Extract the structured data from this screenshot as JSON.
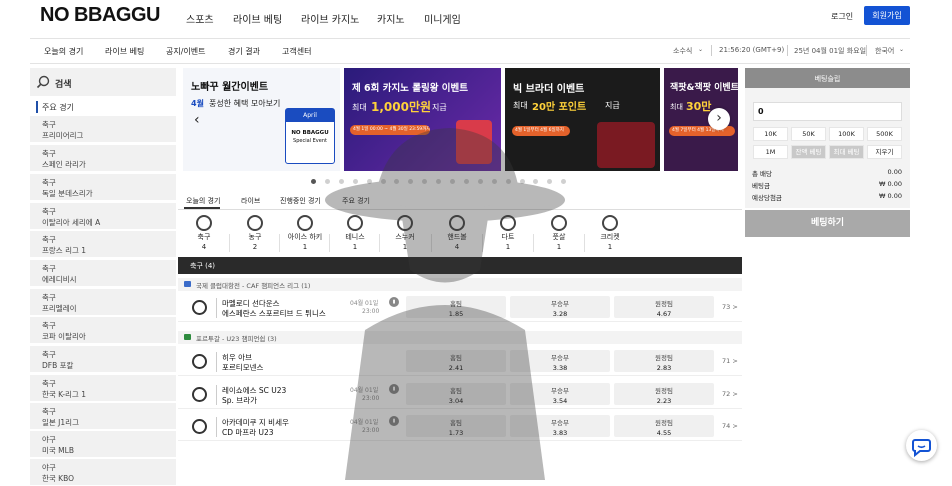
{
  "header": {
    "logo": "NO BBAGGU",
    "nav": [
      "스포츠",
      "라이브 베팅",
      "라이브 카지노",
      "카지노",
      "미니게임"
    ],
    "login": "로그인",
    "signup": "회원가입"
  },
  "subnav": {
    "items": [
      "오늘의 경기",
      "라이브 베팅",
      "공지/이벤트",
      "경기 결과",
      "고객센터"
    ],
    "odds_format": "소수식",
    "time": "21:56:20 (GMT+9)",
    "date": "25년 04월 01일 화요일",
    "language": "한국어"
  },
  "sidebar": {
    "search": "검색",
    "main_games": "주요 경기",
    "items": [
      {
        "cat": "축구",
        "league": "프리미어리그"
      },
      {
        "cat": "축구",
        "league": "스페인 라리가"
      },
      {
        "cat": "축구",
        "league": "독일 분데스리가"
      },
      {
        "cat": "축구",
        "league": "이탈리아 세리에 A"
      },
      {
        "cat": "축구",
        "league": "프랑스 리그 1"
      },
      {
        "cat": "축구",
        "league": "에레디비시"
      },
      {
        "cat": "축구",
        "league": "프리멜레이"
      },
      {
        "cat": "축구",
        "league": "코파 이탈리아"
      },
      {
        "cat": "축구",
        "league": "DFB 포칼"
      },
      {
        "cat": "축구",
        "league": "한국 K-리그 1"
      },
      {
        "cat": "축구",
        "league": "일본 J1리그"
      },
      {
        "cat": "야구",
        "league": "미국 MLB"
      },
      {
        "cat": "야구",
        "league": "한국 KBO"
      }
    ]
  },
  "banners": [
    {
      "title": "노빠꾸 월간이벤트",
      "sub1": "4월",
      "sub2": "풍성한 혜택 모아보기",
      "badge_month": "April",
      "badge_logo": "NO BBAGGU",
      "badge_sub": "Special Event"
    },
    {
      "title": "제 6회 카지노 롤링왕 이벤트",
      "sub1": "최대",
      "highlight": "1,000만원",
      "sub2": "지급",
      "date": "4월 1일 00:00 ~ 4월 30일 23:59까지"
    },
    {
      "title": "빅 브라더 이벤트",
      "sub1": "최대",
      "highlight": "20만 포인트",
      "sub2": "지급",
      "date": "4월 1일부터 4월 6일까지"
    },
    {
      "title": "잭팟&잭팟 이벤트",
      "sub1": "최대",
      "highlight": "30만",
      "date": "4월 7일부터 4월 13일까지"
    }
  ],
  "carousel_dots": 19,
  "tabs": [
    "오늘의 경기",
    "라이브",
    "진행중인 경기",
    "주요 경기"
  ],
  "sports": [
    {
      "name": "축구",
      "count": "4"
    },
    {
      "name": "농구",
      "count": "2"
    },
    {
      "name": "아이스 하키",
      "count": "1"
    },
    {
      "name": "테니스",
      "count": "1"
    },
    {
      "name": "스누커",
      "count": "1"
    },
    {
      "name": "핸드볼",
      "count": "4"
    },
    {
      "name": "다트",
      "count": "1"
    },
    {
      "name": "풋살",
      "count": "1"
    },
    {
      "name": "크리켓",
      "count": "1"
    }
  ],
  "section_header": "축구 (4)",
  "leagues": [
    {
      "name": "국제 클럽대항전 - CAF 챔피언스 리그 (1)",
      "flag": "#3a6bc9"
    },
    {
      "name": "포르투갈 - U23 챔피언쉽 (3)",
      "flag": "#2e8b3e"
    }
  ],
  "matches": [
    {
      "home": "마멜로디 선다운스",
      "away": "에스페란스 스포르티브 드 튀니스",
      "date": "04월 01일",
      "time": "23:00",
      "labels": [
        "홈팀",
        "무승부",
        "원정팀"
      ],
      "odds": [
        "1.85",
        "3.28",
        "4.67"
      ],
      "more": "73 >"
    },
    {
      "home": "히우 아브",
      "away": "포르티모넨스",
      "date": "",
      "time": "",
      "labels": [
        "홈팀",
        "무승부",
        "원정팀"
      ],
      "odds": [
        "2.41",
        "3.38",
        "2.83"
      ],
      "more": "71 >"
    },
    {
      "home": "레이쇼에스 SC U23",
      "away": "Sp. 브라가",
      "date": "04월 01일",
      "time": "23:00",
      "labels": [
        "홈팀",
        "무승부",
        "원정팀"
      ],
      "odds": [
        "3.04",
        "3.54",
        "2.23"
      ],
      "more": "72 >"
    },
    {
      "home": "아카데미쿠 지 비세우",
      "away": "CD 마프라 U23",
      "date": "04월 01일",
      "time": "23:00",
      "labels": [
        "홈팀",
        "무승부",
        "원정팀"
      ],
      "odds": [
        "1.73",
        "3.83",
        "4.55"
      ],
      "more": "74 >"
    }
  ],
  "betslip": {
    "title": "베팅슬립",
    "amount": "0",
    "chips": [
      "10K",
      "50K",
      "100K",
      "500K",
      "1M",
      "잔액 베팅",
      "최대 베팅",
      "지우기"
    ],
    "rows": [
      {
        "label": "총 배당",
        "value": "0.00"
      },
      {
        "label": "베팅금",
        "value": "₩ 0.00"
      },
      {
        "label": "예상당첨금",
        "value": "₩ 0.00"
      }
    ],
    "button": "베팅하기"
  },
  "colors": {
    "accent": "#1353d4",
    "dark": "#2a2a2a",
    "sidebar_bg": "#f1f1f1"
  }
}
